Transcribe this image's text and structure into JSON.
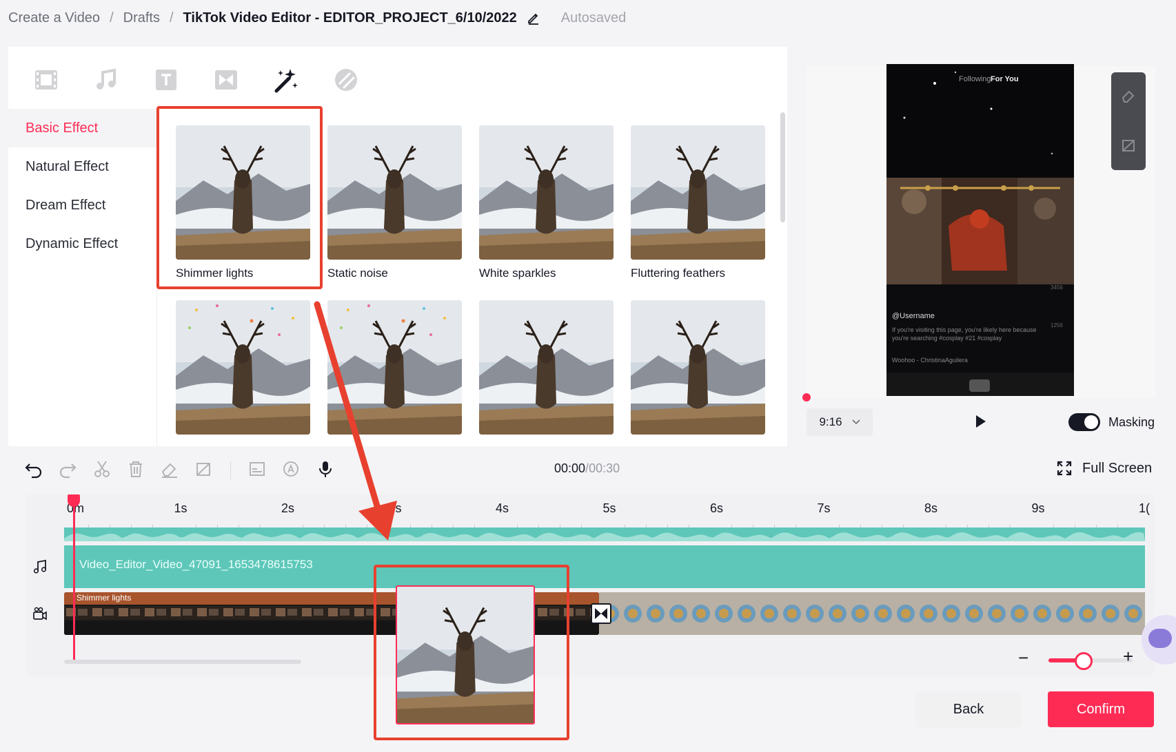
{
  "breadcrumb": {
    "items": [
      "Create a Video",
      "Drafts"
    ],
    "separator": "/",
    "current": "TikTok Video Editor - EDITOR_PROJECT_6/10/2022",
    "status": "Autosaved"
  },
  "toolbar": {
    "tabs": [
      "video-icon",
      "music-icon",
      "text-icon",
      "transition-icon",
      "magic-wand-icon",
      "sticker-icon"
    ],
    "active_tab": "magic-wand-icon"
  },
  "categories": [
    {
      "label": "Basic Effect",
      "active": true
    },
    {
      "label": "Natural Effect",
      "active": false
    },
    {
      "label": "Dream Effect",
      "active": false
    },
    {
      "label": "Dynamic Effect",
      "active": false
    }
  ],
  "effects": [
    {
      "label": "Shimmer lights"
    },
    {
      "label": "Static noise"
    },
    {
      "label": "White sparkles"
    },
    {
      "label": "Fluttering feathers"
    },
    {
      "label": ""
    },
    {
      "label": ""
    },
    {
      "label": ""
    },
    {
      "label": ""
    }
  ],
  "preview": {
    "ratio": "9:16",
    "masking_label": "Masking",
    "masking_on": true,
    "phone": {
      "tabs": [
        "Following",
        "For You"
      ],
      "username": "@Username",
      "caption": "If you're visiting this page, you're likely here because you're searching #cosplay #21 #cosplay",
      "music": "Woohoo - ChristinaAguilera",
      "like_count": "3456",
      "share_count": "1256"
    }
  },
  "timeline": {
    "current_time": "00:00",
    "separator": "/",
    "total_time": "00:30",
    "fullscreen_label": "Full Screen",
    "ruler": [
      "0m",
      "1s",
      "2s",
      "3s",
      "4s",
      "5s",
      "6s",
      "7s",
      "8s",
      "9s",
      "1("
    ],
    "audio_track_name": "Video_Editor_Video_47091_1653478615753",
    "effect_label": "Shimmer lights",
    "zoom_percent": 40
  },
  "buttons": {
    "back": "Back",
    "confirm": "Confirm"
  },
  "colors": {
    "accent": "#fe2c55",
    "audio_track": "#5ec7b9",
    "annotation": "#e8402f"
  }
}
